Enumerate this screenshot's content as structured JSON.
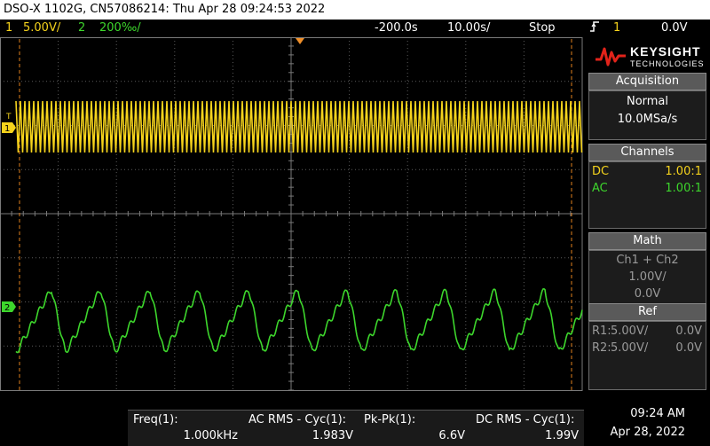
{
  "title": "DSO-X 1102G, CN57086214: Thu Apr 28 09:24:53 2022",
  "status": {
    "ch1_num": "1",
    "ch1_scale": "5.00V/",
    "ch2_num": "2",
    "ch2_scale": "200‰/",
    "time_offset": "-200.0s",
    "time_scale": "10.00s/",
    "run_state": "Stop",
    "trigger_icon": "rising-edge-icon",
    "trigger_source": "1",
    "trigger_level": "0.0V"
  },
  "markers": {
    "trigger_marker": "T",
    "ch1_marker": "1",
    "ch2_marker": "2"
  },
  "colors": {
    "ch1": "#f5d31c",
    "ch2": "#3dd62c",
    "trigger_marker": "#f0902a",
    "cursor": "#e07f1c"
  },
  "panel": {
    "logo": "KEYSIGHT",
    "logo_sub": "TECHNOLOGIES",
    "acquisition_title": "Acquisition",
    "acq_mode": "Normal",
    "acq_rate": "10.0MSa/s",
    "channels_title": "Channels",
    "ch1_coupling": "DC",
    "ch1_probe": "1.00:1",
    "ch2_coupling": "AC",
    "ch2_probe": "1.00:1",
    "math_title": "Math",
    "math_func": "Ch1 + Ch2",
    "math_scale": "1.00V/",
    "math_offset": "0.0V",
    "ref_title": "Ref",
    "r1_label": "R1:",
    "r1_scale": "5.00V/",
    "r1_offset": "0.0V",
    "r2_label": "R2:",
    "r2_scale": "5.00V/",
    "r2_offset": "0.0V"
  },
  "measurements": [
    {
      "label": "Freq(1):",
      "value": "1.000kHz"
    },
    {
      "label": "AC RMS - Cyc(1):",
      "value": "1.983V"
    },
    {
      "label": "Pk-Pk(1):",
      "value": "6.6V"
    },
    {
      "label": "DC RMS - Cyc(1):",
      "value": "1.99V"
    }
  ],
  "clock": {
    "time": "09:24 AM",
    "date": "Apr 28, 2022"
  }
}
